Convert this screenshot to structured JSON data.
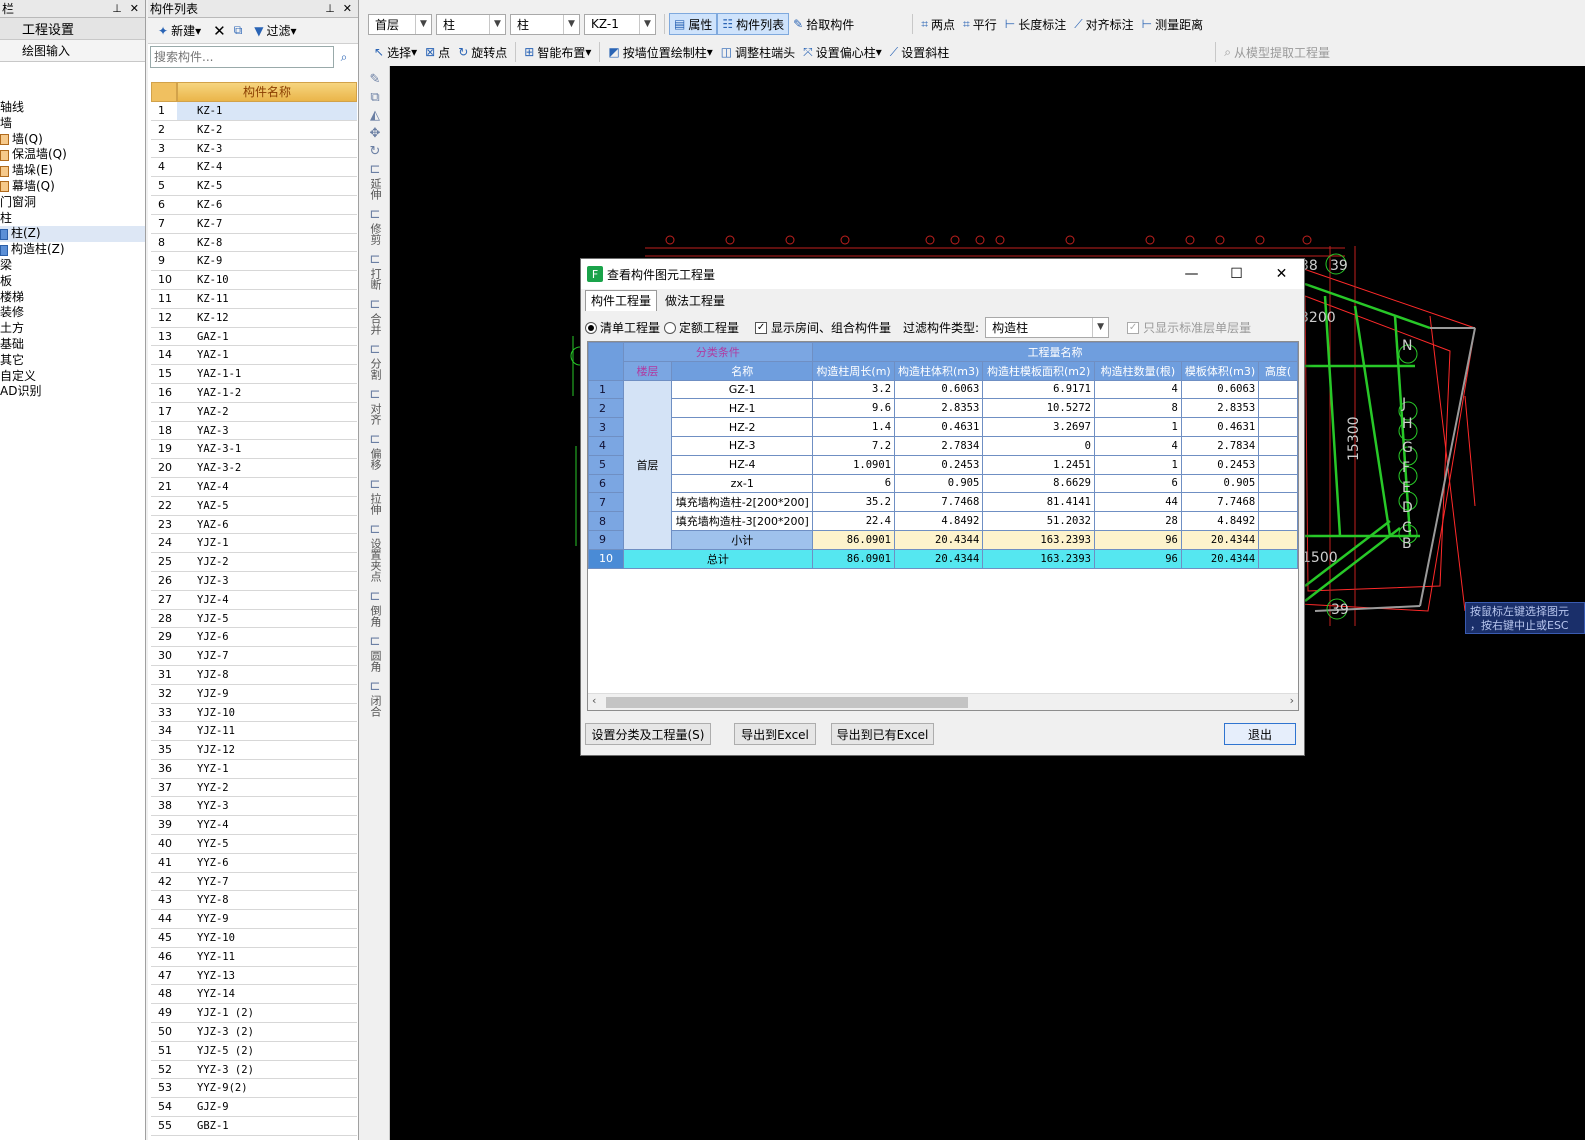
{
  "nav": {
    "header": "栏",
    "btn_project": "工程设置",
    "btn_draw": "绘图输入",
    "tree": [
      {
        "label": "轴线",
        "icon": ""
      },
      {
        "label": "墙",
        "icon": ""
      },
      {
        "label": "墙(Q)",
        "icon": "wall-icon"
      },
      {
        "label": "保温墙(Q)",
        "icon": "wall-icon"
      },
      {
        "label": "墙垛(E)",
        "icon": "wall-icon"
      },
      {
        "label": "幕墙(Q)",
        "icon": "wall-icon"
      },
      {
        "label": "门窗洞",
        "icon": ""
      },
      {
        "label": "柱",
        "icon": ""
      },
      {
        "label": "柱(Z)",
        "icon": "column-icon"
      },
      {
        "label": "构造柱(Z)",
        "icon": "column-icon"
      },
      {
        "label": "梁",
        "icon": ""
      },
      {
        "label": "板",
        "icon": ""
      },
      {
        "label": "楼梯",
        "icon": ""
      },
      {
        "label": "装修",
        "icon": ""
      },
      {
        "label": "土方",
        "icon": ""
      },
      {
        "label": "基础",
        "icon": ""
      },
      {
        "label": "其它",
        "icon": ""
      },
      {
        "label": "自定义",
        "icon": ""
      },
      {
        "label": "AD识别",
        "icon": ""
      }
    ]
  },
  "comp": {
    "header": "构件列表",
    "new_label": "新建",
    "filter_label": "过滤",
    "search_placeholder": "搜索构件...",
    "col_name": "构件名称",
    "rows": [
      "KZ-1",
      "KZ-2",
      "KZ-3",
      "KZ-4",
      "KZ-5",
      "KZ-6",
      "KZ-7",
      "KZ-8",
      "KZ-9",
      "KZ-10",
      "KZ-11",
      "KZ-12",
      "GAZ-1",
      "YAZ-1",
      "YAZ-1-1",
      "YAZ-1-2",
      "YAZ-2",
      "YAZ-3",
      "YAZ-3-1",
      "YAZ-3-2",
      "YAZ-4",
      "YAZ-5",
      "YAZ-6",
      "YJZ-1",
      "YJZ-2",
      "YJZ-3",
      "YJZ-4",
      "YJZ-5",
      "YJZ-6",
      "YJZ-7",
      "YJZ-8",
      "YJZ-9",
      "YJZ-10",
      "YJZ-11",
      "YJZ-12",
      "YYZ-1",
      "YYZ-2",
      "YYZ-3",
      "YYZ-4",
      "YYZ-5",
      "YYZ-6",
      "YYZ-7",
      "YYZ-8",
      "YYZ-9",
      "YYZ-10",
      "YYZ-11",
      "YYZ-13",
      "YYZ-14",
      "YJZ-1 (2)",
      "YJZ-3 (2)",
      "YJZ-5 (2)",
      "YYZ-3 (2)",
      "YYZ-9(2)",
      "GJZ-9",
      "GBZ-1"
    ]
  },
  "toolbar": {
    "floor": "首层",
    "type1": "柱",
    "type2": "柱",
    "comp": "KZ-1",
    "attr": "属性",
    "complist": "构件列表",
    "pick": "拾取构件",
    "twopoint": "两点",
    "parallel": "平行",
    "lenmark": "长度标注",
    "alignmark": "对齐标注",
    "measure": "测量距离",
    "select": "选择",
    "point": "点",
    "rotpoint": "旋转点",
    "smart": "智能布置",
    "bywall": "按墙位置绘制柱",
    "adjust": "调整柱端头",
    "offset": "设置偏心柱",
    "slant": "设置斜柱",
    "extract": "从模型提取工程量"
  },
  "vstrip": [
    "延伸",
    "修剪",
    "打断",
    "合并",
    "分割",
    "对齐",
    "偏移",
    "拉伸",
    "设置夹点",
    "倒角",
    "圆角",
    "闭合"
  ],
  "hint": {
    "line1": "按鼠标左键选择图元",
    "line2": "，按右键中止或ESC"
  },
  "canvas_labels": [
    "38",
    "39",
    "N",
    "J",
    "H",
    "G",
    "F",
    "E",
    "D",
    "C",
    "B",
    "3200",
    "15300",
    "1500",
    "39"
  ],
  "dialog": {
    "title": "查看构件图元工程量",
    "tab1": "构件工程量",
    "tab2": "做法工程量",
    "radio1": "清单工程量",
    "radio2": "定额工程量",
    "chk_room": "显示房间、组合构件量",
    "filter_label": "过滤构件类型:",
    "filter_value": "构造柱",
    "chk_std": "只显示标准层单层量",
    "grp_class": "分类条件",
    "grp_qty": "工程量名称",
    "col_floor": "楼层",
    "col_name": "名称",
    "cols": [
      "构造柱周长(m)",
      "构造柱体积(m3)",
      "构造柱模板面积(m2)",
      "构造柱数量(根)",
      "模板体积(m3)",
      "高度("
    ],
    "floor": "首层",
    "rows": [
      {
        "n": "1",
        "name": "GZ-1",
        "v": [
          "3.2",
          "0.6063",
          "6.9171",
          "4",
          "0.6063"
        ]
      },
      {
        "n": "2",
        "name": "HZ-1",
        "v": [
          "9.6",
          "2.8353",
          "10.5272",
          "8",
          "2.8353"
        ]
      },
      {
        "n": "3",
        "name": "HZ-2",
        "v": [
          "1.4",
          "0.4631",
          "3.2697",
          "1",
          "0.4631"
        ]
      },
      {
        "n": "4",
        "name": "HZ-3",
        "v": [
          "7.2",
          "2.7834",
          "0",
          "4",
          "2.7834"
        ]
      },
      {
        "n": "5",
        "name": "HZ-4",
        "v": [
          "1.0901",
          "0.2453",
          "1.2451",
          "1",
          "0.2453"
        ]
      },
      {
        "n": "6",
        "name": "zx-1",
        "v": [
          "6",
          "0.905",
          "8.6629",
          "6",
          "0.905"
        ]
      },
      {
        "n": "7",
        "name": "填充墙构造柱-2[200*200]",
        "v": [
          "35.2",
          "7.7468",
          "81.4141",
          "44",
          "7.7468"
        ]
      },
      {
        "n": "8",
        "name": "填充墙构造柱-3[200*200]",
        "v": [
          "22.4",
          "4.8492",
          "51.2032",
          "28",
          "4.8492"
        ]
      }
    ],
    "subtotal": {
      "n": "9",
      "label": "小计",
      "v": [
        "86.0901",
        "20.4344",
        "163.2393",
        "96",
        "20.4344"
      ]
    },
    "total": {
      "n": "10",
      "label": "总计",
      "v": [
        "86.0901",
        "20.4344",
        "163.2393",
        "96",
        "20.4344"
      ]
    },
    "btn_setup": "设置分类及工程量(S)",
    "btn_export": "导出到Excel",
    "btn_export2": "导出到已有Excel",
    "btn_exit": "退出"
  }
}
